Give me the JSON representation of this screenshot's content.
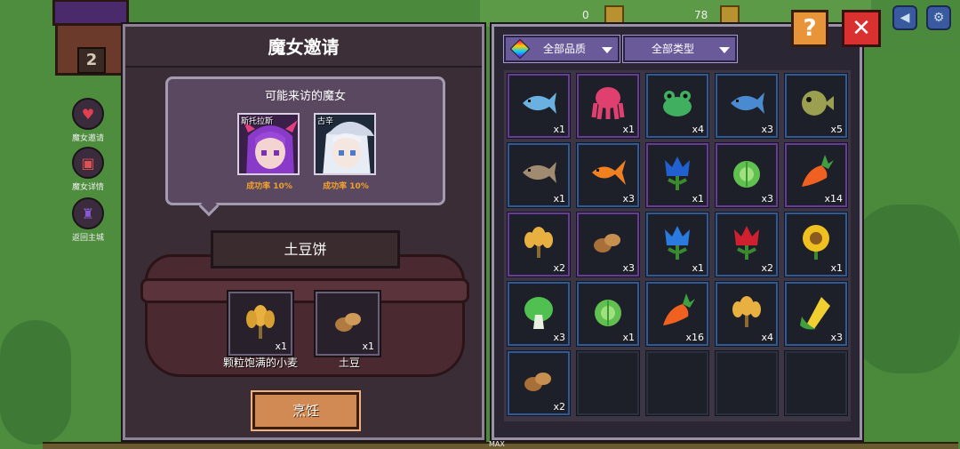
{
  "background": {
    "house_number": "2",
    "side_buttons": [
      {
        "label": "魔女邀请",
        "icon": "heart-icon"
      },
      {
        "label": "魔女详情",
        "icon": "gift-icon"
      },
      {
        "label": "返回主城",
        "icon": "castle-icon"
      }
    ],
    "top_resources": [
      {
        "value": "0",
        "icon": "coin-icon"
      },
      {
        "value": "78",
        "icon": "coin-icon"
      }
    ]
  },
  "left_panel": {
    "title": "魔女邀请",
    "visitor_box": {
      "title": "可能来访的魔女",
      "witches": [
        {
          "name": "斯托拉斯",
          "rate": "成功率 10%",
          "hair_color": "#8a3ac8"
        },
        {
          "name": "古辛",
          "rate": "成功率 10%",
          "hair_color": "#e8ecf4"
        }
      ]
    },
    "dish_name": "土豆饼",
    "ingredients": [
      {
        "label": "颗粒饱满的小麦",
        "qty": "x1",
        "icon": "wheat-icon"
      },
      {
        "label": "土豆",
        "qty": "x1",
        "icon": "potato-icon"
      }
    ],
    "cook_button": "烹饪"
  },
  "right_panel": {
    "filters": {
      "quality": "全部品质",
      "type": "全部类型"
    },
    "items": [
      {
        "icon": "fish-icon",
        "qty": "x1",
        "rarity": "epic",
        "color": "#6ab0e0"
      },
      {
        "icon": "octopus-icon",
        "qty": "x1",
        "rarity": "epic",
        "color": "#e04070"
      },
      {
        "icon": "frog-icon",
        "qty": "x4",
        "rarity": "rare",
        "color": "#40b060"
      },
      {
        "icon": "fish-icon",
        "qty": "x3",
        "rarity": "rare",
        "color": "#4a8ad0"
      },
      {
        "icon": "pufferfish-icon",
        "qty": "x5",
        "rarity": "rare",
        "color": "#9aa050"
      },
      {
        "icon": "fish-icon",
        "qty": "x1",
        "rarity": "rare",
        "color": "#a08a70"
      },
      {
        "icon": "goldfish-icon",
        "qty": "x3",
        "rarity": "rare",
        "color": "#f08020"
      },
      {
        "icon": "flower-icon",
        "qty": "x1",
        "rarity": "epic",
        "color": "#2060d0"
      },
      {
        "icon": "cabbage-icon",
        "qty": "x3",
        "rarity": "epic",
        "color": "#60c050"
      },
      {
        "icon": "carrot-icon",
        "qty": "x14",
        "rarity": "epic",
        "color": "#f06020"
      },
      {
        "icon": "wheat-icon",
        "qty": "x2",
        "rarity": "epic",
        "color": "#e8b040"
      },
      {
        "icon": "potato-icon",
        "qty": "x3",
        "rarity": "epic",
        "color": "#c89050"
      },
      {
        "icon": "flower-icon",
        "qty": "x1",
        "rarity": "rare",
        "color": "#2a7ae0"
      },
      {
        "icon": "flower-icon",
        "qty": "x2",
        "rarity": "rare",
        "color": "#d02030"
      },
      {
        "icon": "sunflower-icon",
        "qty": "x1",
        "rarity": "rare",
        "color": "#f0c020"
      },
      {
        "icon": "bokchoy-icon",
        "qty": "x3",
        "rarity": "rare",
        "color": "#50c050"
      },
      {
        "icon": "cabbage-icon",
        "qty": "x1",
        "rarity": "rare",
        "color": "#60c050"
      },
      {
        "icon": "carrot-icon",
        "qty": "x16",
        "rarity": "rare",
        "color": "#f06020"
      },
      {
        "icon": "wheat-icon",
        "qty": "x4",
        "rarity": "rare",
        "color": "#e8b040"
      },
      {
        "icon": "corn-icon",
        "qty": "x3",
        "rarity": "rare",
        "color": "#f0d030"
      },
      {
        "icon": "potato-icon",
        "qty": "x2",
        "rarity": "rare",
        "color": "#c89050"
      },
      {
        "icon": "",
        "qty": "",
        "rarity": "empty"
      },
      {
        "icon": "",
        "qty": "",
        "rarity": "empty"
      },
      {
        "icon": "",
        "qty": "",
        "rarity": "empty"
      },
      {
        "icon": "",
        "qty": "",
        "rarity": "empty"
      }
    ]
  },
  "buttons": {
    "help": "?",
    "close": "✕"
  },
  "footer": {
    "max_label": "MAX"
  }
}
